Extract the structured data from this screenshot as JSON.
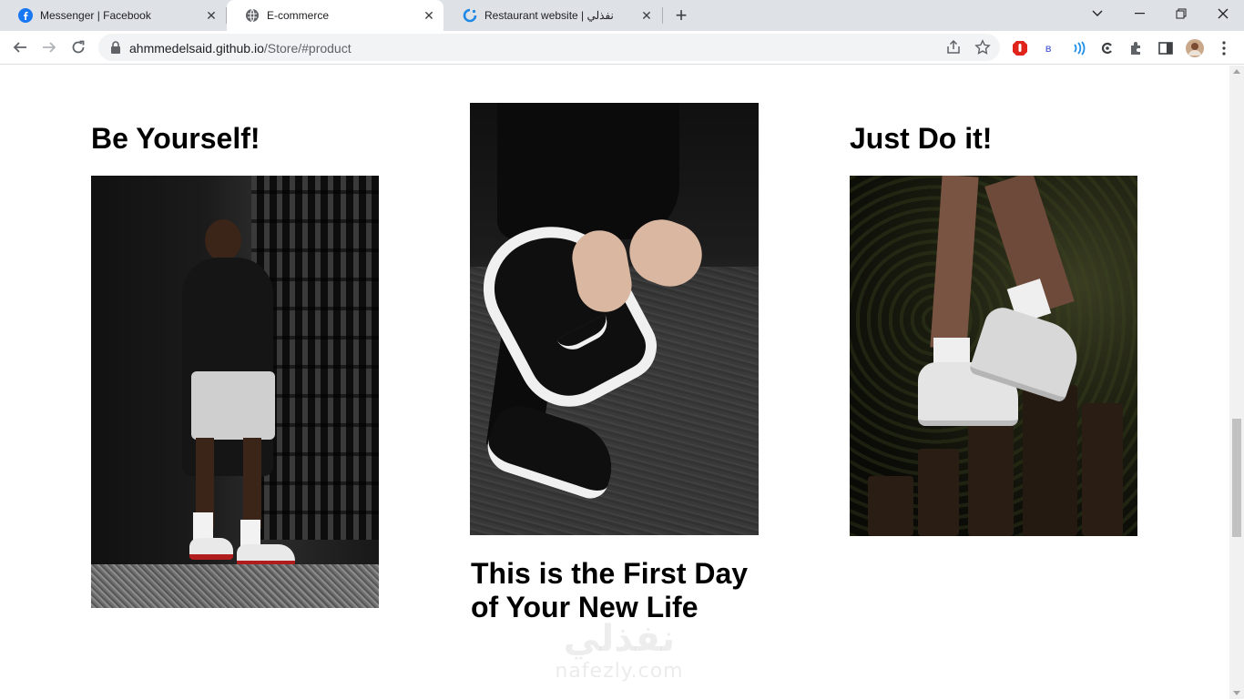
{
  "browser": {
    "tabs": [
      {
        "label": "Messenger | Facebook",
        "icon": "facebook-icon",
        "active": false
      },
      {
        "label": "E-commerce",
        "icon": "globe-icon",
        "active": true
      },
      {
        "label": "Restaurant website | نفذلي",
        "icon": "nafezly-icon",
        "active": false
      }
    ],
    "new_tab_label": "+",
    "close_label": "✕",
    "window_controls": {
      "dropdown": "⌄",
      "minimize": "—",
      "restore": "❐",
      "close": "✕"
    },
    "url": {
      "host": "ahmmedelsaid.github.io",
      "path": "/Store/#product"
    },
    "colors": {
      "tabbar_bg": "#dee1e6",
      "active_tab_bg": "#ffffff",
      "omnibox_bg": "#f1f3f4"
    }
  },
  "page": {
    "sections": [
      {
        "heading": "Be Yourself!",
        "image": "man-standing-in-sneakers"
      },
      {
        "heading": "This is the First Day of Your New Life",
        "image": "hands-holding-black-white-sneaker"
      },
      {
        "heading": "Just Do it!",
        "image": "white-high-top-sneakers-on-stumps"
      }
    ],
    "watermark": {
      "arabic": "نفذلي",
      "latin": "nafezly.com"
    }
  }
}
